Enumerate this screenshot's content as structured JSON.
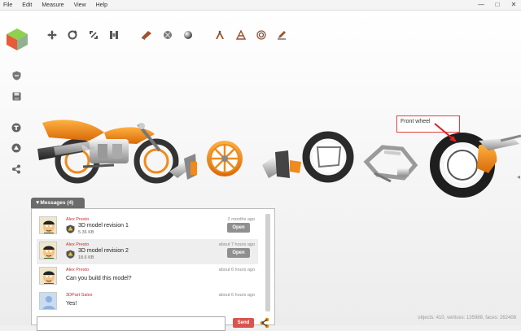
{
  "menubar": {
    "items": [
      {
        "label": "File"
      },
      {
        "label": "Edit"
      },
      {
        "label": "Measure"
      },
      {
        "label": "View"
      },
      {
        "label": "Help"
      }
    ]
  },
  "window_controls": {
    "minimize": "—",
    "maximize": "□",
    "close": "✕"
  },
  "toolbar": {
    "icons": [
      "move-icon",
      "rotate-icon",
      "fit-view-icon",
      "explode-icon",
      "material-icon",
      "shading-icon",
      "sphere-icon",
      "measure-icon",
      "section-icon",
      "target-icon",
      "pencil-icon"
    ]
  },
  "sidebar": {
    "icons": [
      "shield-icon",
      "save-icon",
      "text-icon",
      "upload-icon",
      "share-icon"
    ]
  },
  "annotation": {
    "text": "Front wheel"
  },
  "messages_panel": {
    "tab_label": "▼Messages (4)",
    "messages": [
      {
        "author": "Alex Presto",
        "time": "2 months ago",
        "file_name": "3D model revision 1",
        "file_size": "5.36 KB",
        "action": "Open"
      },
      {
        "author": "Alex Presto",
        "time": "about 7 hours ago",
        "file_name": "3D model revision 2",
        "file_size": "18.6 KB",
        "action": "Open"
      },
      {
        "author": "Alex Presto",
        "time": "about 6 hours ago",
        "text": "Can you build this model?"
      },
      {
        "author": "3DPart Sales",
        "time": "about 6 hours ago",
        "text": "Yes!"
      }
    ],
    "input_placeholder": "",
    "send_label": "Send"
  },
  "status_bar": {
    "text": "objects: 410, vertices: 135988, faces: 262408"
  },
  "colors": {
    "accent_orange": "#f08a1c",
    "send_red": "#d9534f",
    "author_red": "#c03030",
    "annotation_red": "#e04040"
  }
}
